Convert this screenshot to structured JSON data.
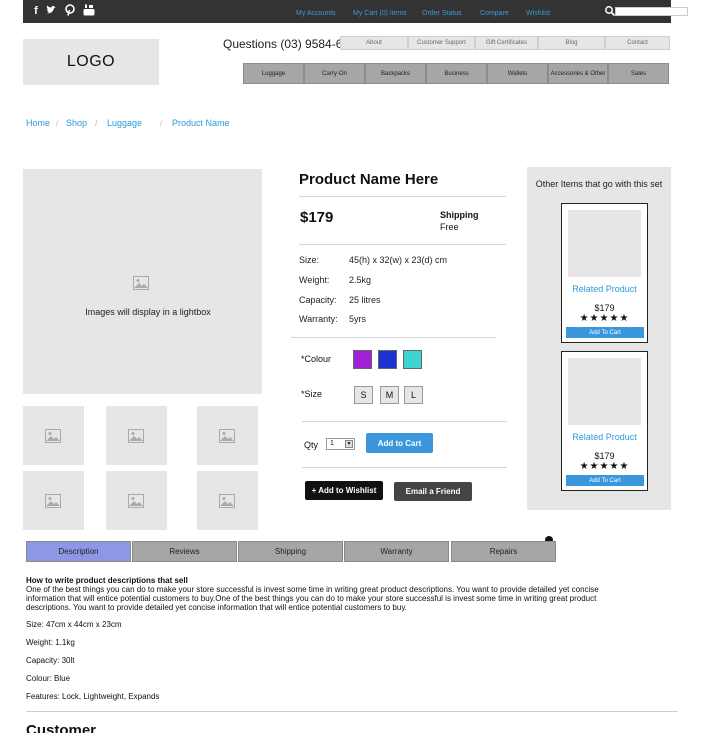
{
  "topbar": {
    "social": [
      "f",
      "t",
      "p",
      "yt"
    ],
    "links": [
      "My Accounts",
      "My Cart (0) items",
      "Order Status",
      "Compare",
      "Wishlist"
    ],
    "search_placeholder": ""
  },
  "header": {
    "logo": "LOGO",
    "phone": "Questions (03) 9584-6344",
    "utility_links": [
      "About",
      "Customer Support",
      "Gift Certificates",
      "Blog",
      "Contact"
    ],
    "categories": [
      "Luggage",
      "Carry-On",
      "Backpacks",
      "Business",
      "Wallets",
      "Accessories & Other",
      "Sales"
    ]
  },
  "breadcrumb": [
    "Home",
    "Shop",
    "Luggage",
    "Product Name"
  ],
  "gallery": {
    "main_caption": "Images will display in a lightbox",
    "thumbnail_count": 6
  },
  "product": {
    "name": "Product Name Here",
    "price": "$179",
    "shipping_label": "Shipping",
    "shipping_value": "Free",
    "specs": [
      {
        "label": "Size:",
        "value": "45(h) x 32(w) x 23(d) cm"
      },
      {
        "label": "Weight:",
        "value": "2.5kg"
      },
      {
        "label": "Capacity:",
        "value": "25 litres"
      },
      {
        "label": "Warranty:",
        "value": "5yrs"
      }
    ],
    "colour_label": "*Colour",
    "colours": [
      "#a020d8",
      "#1b34d1",
      "#3fd4d4"
    ],
    "size_label": "*Size",
    "sizes": [
      "S",
      "M",
      "L"
    ],
    "qty_label": "Qty",
    "qty_value": "1",
    "add_to_cart": "Add to Cart",
    "add_to_wishlist": "+ Add to Wishlist",
    "email_friend": "Email a Friend"
  },
  "related": {
    "title": "Other Items that go with this set",
    "items": [
      {
        "name": "Related Product",
        "price": "$179",
        "stars": "★★★★★",
        "button": "Add To Cart"
      },
      {
        "name": "Related Product",
        "price": "$179",
        "stars": "★★★★★",
        "button": "Add To Cart"
      }
    ]
  },
  "tabs": {
    "items": [
      "Description",
      "Reviews",
      "Shipping",
      "Warranty",
      "Repairs"
    ],
    "active": "Description"
  },
  "description": {
    "title": "How to write product descriptions that sell",
    "body": "One of the best things you can do to make your store successful is invest some time in writing great product descriptions. You want to provide detailed yet concise information that will entice potential customers to buy.One of the best things you can do to make your store successful is invest some time in writing great product descriptions. You want to provide detailed yet concise information that will entice potential customers to buy.",
    "lines": [
      "Size: 47cm x 44cm x 23cm",
      "Weight: 1.1kg",
      "Capacity: 30lt",
      "Colour:  Blue",
      "Features: Lock, Lightweight, Expands"
    ]
  },
  "customer_heading": "Customer",
  "colors": {
    "accent": "#3a97dc",
    "link": "#2a9bdc",
    "active_tab": "#8d97e6",
    "topbar": "#333333"
  }
}
